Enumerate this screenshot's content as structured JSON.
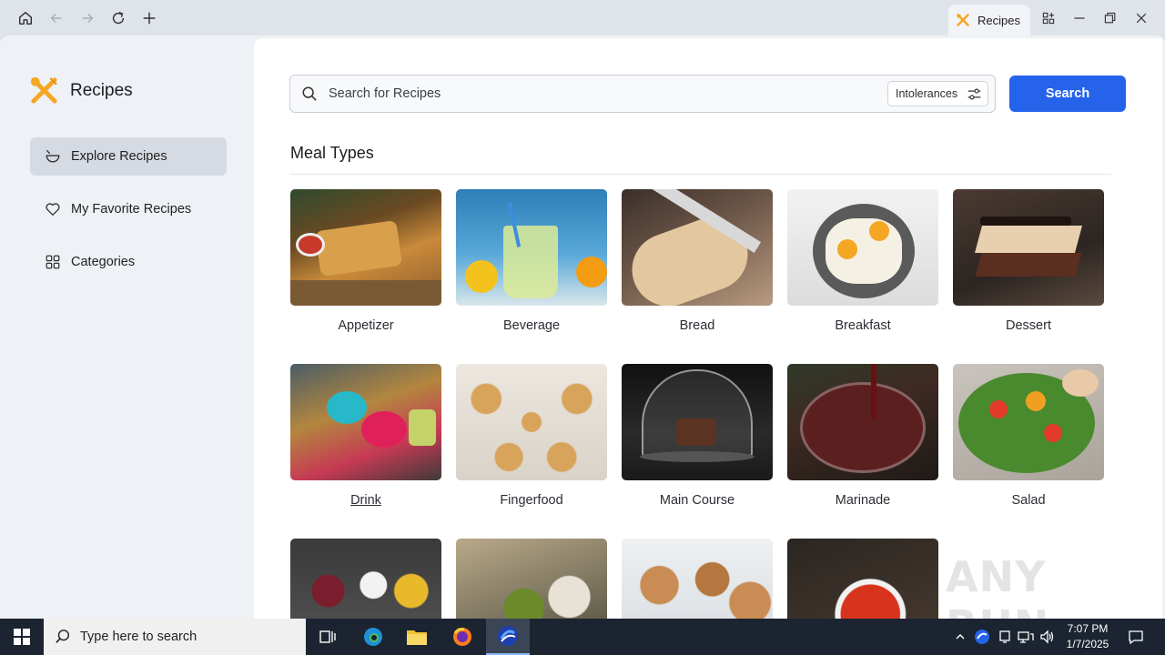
{
  "tab": {
    "label": "Recipes"
  },
  "sidebar": {
    "brand": "Recipes",
    "items": [
      {
        "label": "Explore Recipes",
        "icon": "bowl-icon",
        "active": true
      },
      {
        "label": "My Favorite Recipes",
        "icon": "heart-icon",
        "active": false
      },
      {
        "label": "Categories",
        "icon": "grid-icon",
        "active": false
      }
    ]
  },
  "search": {
    "placeholder": "Search for Recipes",
    "value": "",
    "intolerances_label": "Intolerances",
    "button_label": "Search"
  },
  "meal_types": {
    "title": "Meal Types",
    "items": [
      {
        "label": "Appetizer"
      },
      {
        "label": "Beverage"
      },
      {
        "label": "Bread"
      },
      {
        "label": "Breakfast"
      },
      {
        "label": "Dessert"
      },
      {
        "label": "Drink"
      },
      {
        "label": "Fingerfood"
      },
      {
        "label": "Main Course"
      },
      {
        "label": "Marinade"
      },
      {
        "label": "Salad"
      },
      {
        "label": ""
      },
      {
        "label": ""
      },
      {
        "label": ""
      },
      {
        "label": ""
      }
    ]
  },
  "watermark": "ANY RUN",
  "taskbar": {
    "search_placeholder": "Type here to search",
    "time": "7:07 PM",
    "date": "1/7/2025"
  },
  "colors": {
    "accent": "#2563eb",
    "brand_orange": "#f5a623",
    "sidebar_bg": "#eef1f5",
    "active_item_bg": "#d6dae2",
    "taskbar_bg": "#1b2430"
  }
}
